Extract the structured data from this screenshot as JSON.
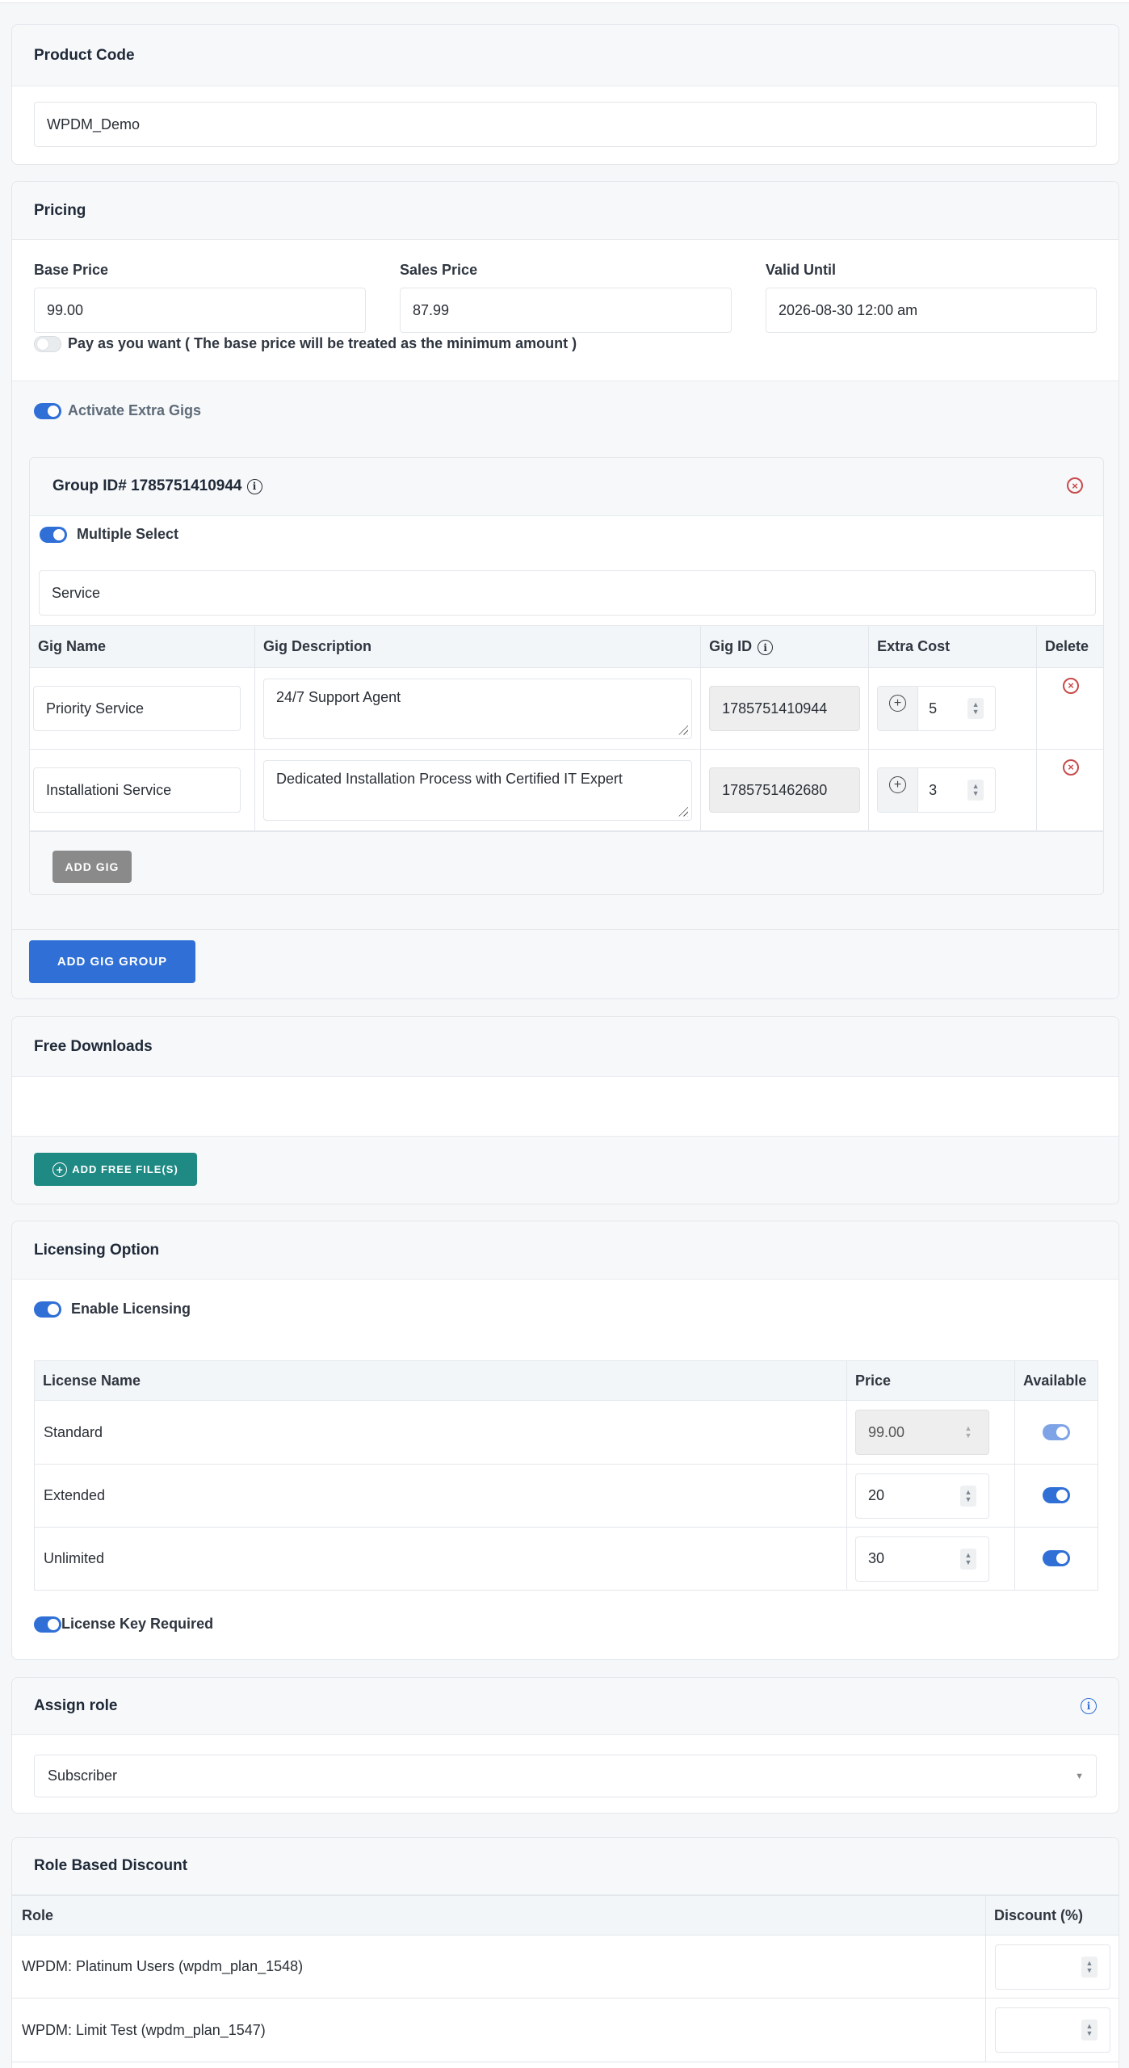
{
  "product_code": {
    "title": "Product Code",
    "value": "WPDM_Demo"
  },
  "pricing": {
    "title": "Pricing",
    "base_price_label": "Base Price",
    "base_price": "99.00",
    "sales_price_label": "Sales Price",
    "sales_price": "87.99",
    "valid_until_label": "Valid Until",
    "valid_until": "2026-08-30 12:00 am",
    "pay_as_you_want": "Pay as you want ( The base price will be treated as the minimum amount )",
    "extra_gigs_label": "Activate Extra Gigs",
    "group": {
      "title": "Group ID# 1785751410944",
      "multiple_select_label": "Multiple Select",
      "group_name": "Service",
      "headers": {
        "name": "Gig Name",
        "desc": "Gig Description",
        "id": "Gig ID",
        "cost": "Extra Cost",
        "delete": "Delete"
      },
      "rows": [
        {
          "name": "Priority Service",
          "desc": "24/7 Support Agent",
          "id": "1785751410944",
          "cost": "5"
        },
        {
          "name": "Installationi Service",
          "desc": "Dedicated Installation Process with Certified IT Expert",
          "id": "1785751462680",
          "cost": "3"
        }
      ],
      "add_gig": "ADD GIG"
    },
    "add_gig_group": "ADD GIG GROUP"
  },
  "free_downloads": {
    "title": "Free Downloads",
    "add_button": "ADD FREE FILE(S)"
  },
  "licensing": {
    "title": "Licensing Option",
    "enable_label": "Enable Licensing",
    "headers": {
      "name": "License Name",
      "price": "Price",
      "available": "Available"
    },
    "rows": [
      {
        "name": "Standard",
        "price": "99.00"
      },
      {
        "name": "Extended",
        "price": "20"
      },
      {
        "name": "Unlimited",
        "price": "30"
      }
    ],
    "key_required_label": "License Key Required"
  },
  "assign_role": {
    "title": "Assign role",
    "selected": "Subscriber"
  },
  "role_discount": {
    "title": "Role Based Discount",
    "headers": {
      "role": "Role",
      "discount": "Discount (%)"
    },
    "rows": [
      {
        "role": "WPDM: Platinum Users (wpdm_plan_1548)"
      },
      {
        "role": "WPDM: Limit Test (wpdm_plan_1547)"
      }
    ]
  },
  "colors": {
    "accent": "#2f6fd6",
    "teal": "#1f8a84",
    "gray_button": "#8a8a8a",
    "danger": "#c94a4a"
  }
}
